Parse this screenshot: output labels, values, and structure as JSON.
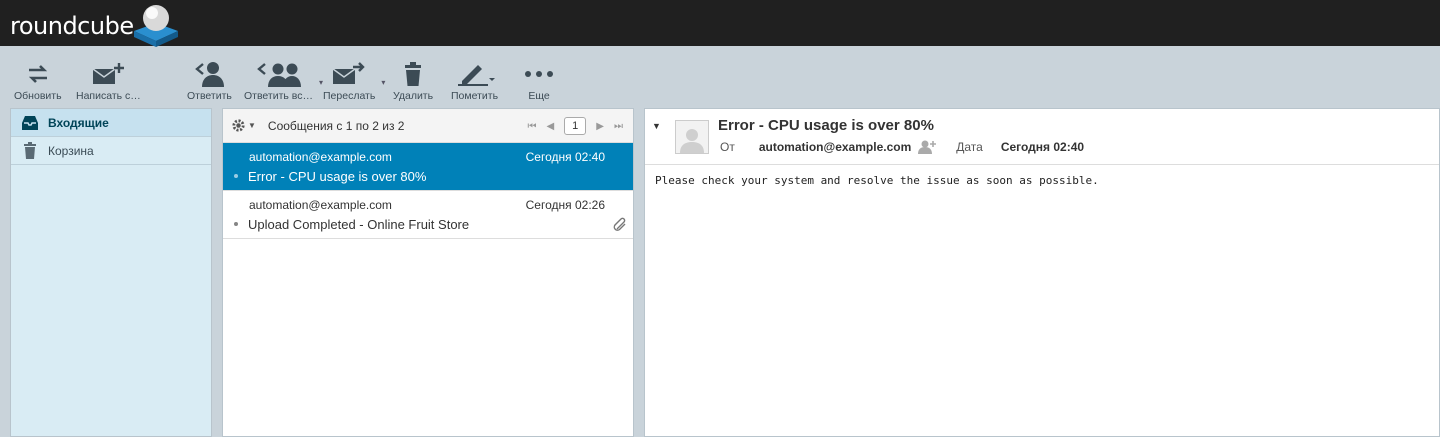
{
  "app": {
    "logo_text": "roundcube"
  },
  "toolbar": {
    "refresh": "Обновить",
    "compose": "Написать с…",
    "reply": "Ответить",
    "reply_all": "Ответить вс…",
    "forward": "Переслать",
    "delete": "Удалить",
    "mark": "Пометить",
    "more": "Еще"
  },
  "folders": [
    {
      "label": "Входящие",
      "icon": "inbox-icon",
      "selected": true
    },
    {
      "label": "Корзина",
      "icon": "trash-icon",
      "selected": false
    }
  ],
  "list": {
    "count_text": "Сообщения с 1 по 2 из 2",
    "page": "1",
    "messages": [
      {
        "from": "automation@example.com",
        "date": "Сегодня 02:40",
        "subject": "Error - CPU usage is over 80%",
        "selected": true,
        "attachment": false
      },
      {
        "from": "automation@example.com",
        "date": "Сегодня 02:26",
        "subject": "Upload Completed - Online Fruit Store",
        "selected": false,
        "attachment": true
      }
    ]
  },
  "preview": {
    "subject": "Error - CPU usage is over 80%",
    "from_label": "От",
    "from": "automation@example.com",
    "date_label": "Дата",
    "date": "Сегодня 02:40",
    "body": "Please check your system and resolve the issue as soon as possible."
  },
  "colors": {
    "header_bg": "#202020",
    "toolbar_bg": "#c9d3da",
    "selected_row": "#0081b8",
    "folder_bg": "#d9ecf4"
  }
}
